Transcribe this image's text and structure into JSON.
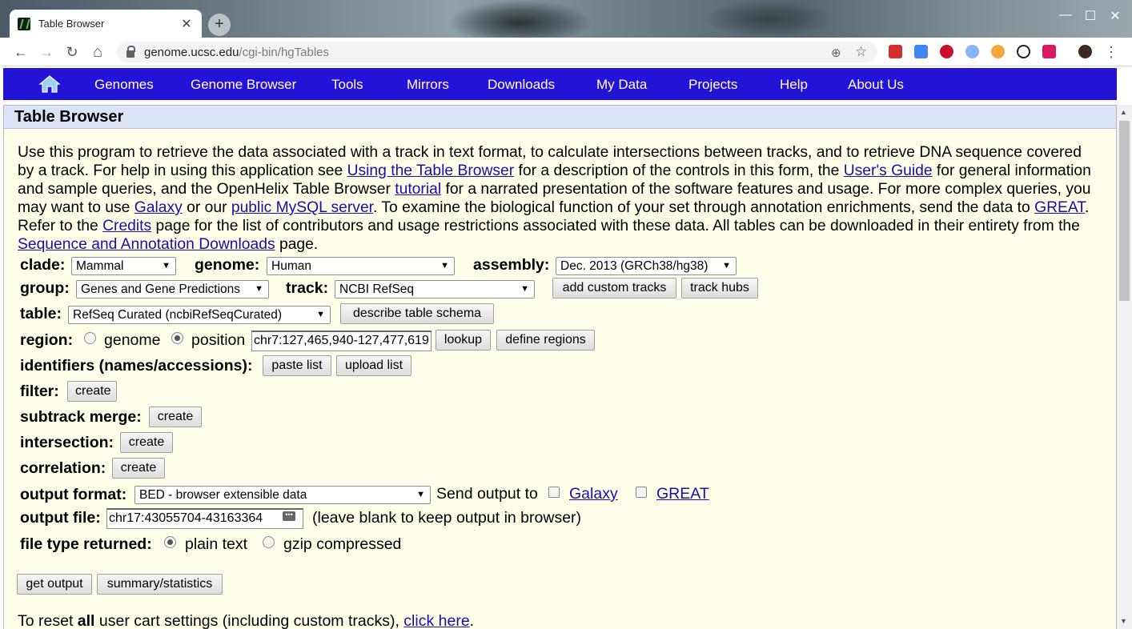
{
  "browser": {
    "tab_title": "Table Browser",
    "tab_close": "✕",
    "new_tab": "+",
    "win_minimize": "—",
    "win_maximize": "☐",
    "win_close": "✕",
    "back": "←",
    "forward": "→",
    "reload": "↻",
    "home": "⌂",
    "url_host": "genome.ucsc.edu",
    "url_path": "/cgi-bin/hgTables",
    "zoom_icon": "⊕",
    "star_icon": "☆",
    "menu_icon": "⋮",
    "extensions": [
      "red-dots",
      "translate",
      "adblock",
      "feedly",
      "fox",
      "timer",
      "stop-sign",
      "profile"
    ]
  },
  "navbar": {
    "items": [
      "Genomes",
      "Genome Browser",
      "Tools",
      "Mirrors",
      "Downloads",
      "My Data",
      "Projects",
      "Help",
      "About Us"
    ]
  },
  "page": {
    "title": "Table Browser",
    "intro": {
      "t1": "Use this program to retrieve the data associated with a track in text format, to calculate intersections between tracks, and to retrieve DNA sequence covered by a track. For help in using this application see ",
      "l1": "Using the Table Browser",
      "t2": " for a description of the controls in this form, the ",
      "l2": "User's Guide",
      "t3": " for general information and sample queries, and the OpenHelix Table Browser ",
      "l3": "tutorial",
      "t4": " for a narrated presentation of the software features and usage. For more complex queries, you may want to use ",
      "l4": "Galaxy",
      "t5": " or our ",
      "l5": "public MySQL server",
      "t6": ". To examine the biological function of your set through annotation enrichments, send the data to ",
      "l6": "GREAT",
      "t7": ". Refer to the ",
      "l7": "Credits",
      "t8": " page for the list of contributors and usage restrictions associated with these data. All tables can be downloaded in their entirety from the ",
      "l8": "Sequence and Annotation Downloads",
      "t9": " page."
    }
  },
  "form": {
    "clade_label": "clade:",
    "clade_value": "Mammal",
    "genome_label": "genome:",
    "genome_value": "Human",
    "assembly_label": "assembly:",
    "assembly_value": "Dec. 2013 (GRCh38/hg38)",
    "group_label": "group:",
    "group_value": "Genes and Gene Predictions",
    "track_label": "track:",
    "track_value": "NCBI RefSeq",
    "add_custom_tracks": "add custom tracks",
    "track_hubs": "track hubs",
    "table_label": "table:",
    "table_value": "RefSeq Curated (ncbiRefSeqCurated)",
    "describe_schema": "describe table schema",
    "region_label": "region:",
    "region_genome": "genome",
    "region_position": "position",
    "position_value": "chr7:127,465,940-127,477,619",
    "lookup": "lookup",
    "define_regions": "define regions",
    "identifiers_label": "identifiers (names/accessions):",
    "paste_list": "paste list",
    "upload_list": "upload list",
    "filter_label": "filter:",
    "subtrack_merge_label": "subtrack merge:",
    "intersection_label": "intersection:",
    "correlation_label": "correlation:",
    "create": "create",
    "output_format_label": "output format:",
    "output_format_value": "BED - browser extensible data",
    "send_output_to": "Send output to",
    "galaxy": "Galaxy",
    "great": "GREAT",
    "output_file_label": "output file:",
    "output_file_value": "chr17:43055704-43163364",
    "output_file_hint": "(leave blank to keep output in browser)",
    "file_type_label": "file type returned:",
    "file_type_plain": "plain text",
    "file_type_gzip": "gzip compressed",
    "get_output": "get output",
    "summary_statistics": "summary/statistics",
    "reset_pre": "To reset ",
    "reset_bold": "all",
    "reset_post": " user cart settings (including custom tracks), ",
    "reset_link": "click here",
    "reset_end": "."
  }
}
